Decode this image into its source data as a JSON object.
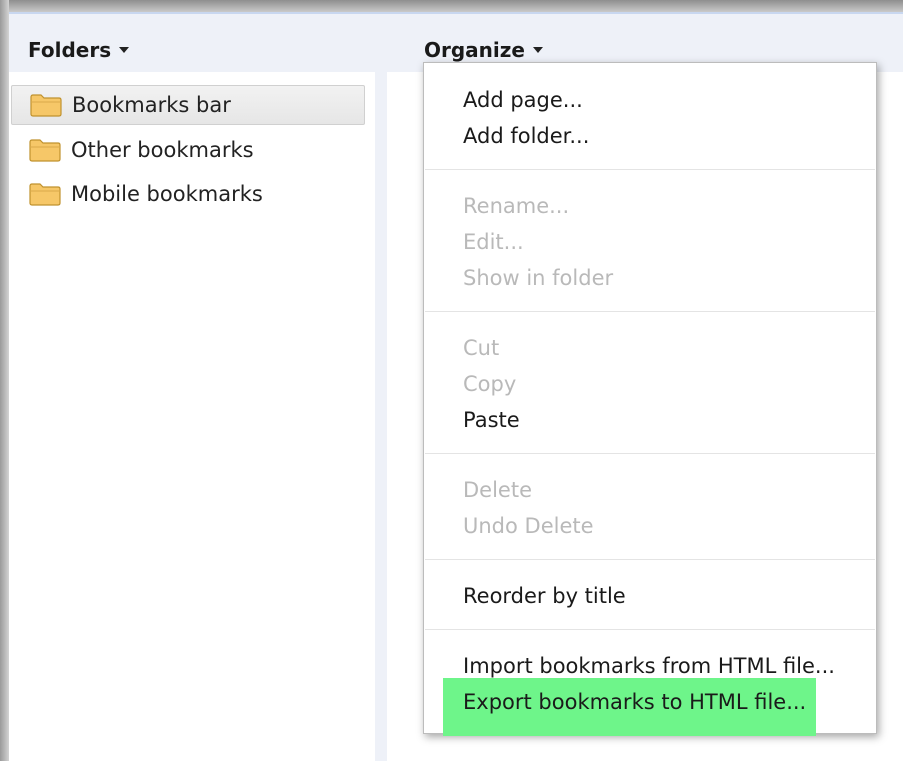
{
  "header": {
    "folders_label": "Folders",
    "organize_label": "Organize"
  },
  "sidebar": {
    "items": [
      {
        "label": "Bookmarks bar",
        "selected": true
      },
      {
        "label": "Other bookmarks",
        "selected": false
      },
      {
        "label": "Mobile bookmarks",
        "selected": false
      }
    ]
  },
  "organize_menu": {
    "items": [
      {
        "label": "Add page...",
        "enabled": true
      },
      {
        "label": "Add folder...",
        "enabled": true
      },
      {
        "label": "Rename...",
        "enabled": false
      },
      {
        "label": "Edit...",
        "enabled": false
      },
      {
        "label": "Show in folder",
        "enabled": false
      },
      {
        "label": "Cut",
        "enabled": false
      },
      {
        "label": "Copy",
        "enabled": false
      },
      {
        "label": "Paste",
        "enabled": true
      },
      {
        "label": "Delete",
        "enabled": false
      },
      {
        "label": "Undo Delete",
        "enabled": false
      },
      {
        "label": "Reorder by title",
        "enabled": true
      },
      {
        "label": "Import bookmarks from HTML file...",
        "enabled": true
      },
      {
        "label": "Export bookmarks to HTML file...",
        "enabled": true,
        "highlighted": true
      }
    ],
    "highlight_color": "#6ef58a"
  },
  "icons": {
    "folder": "folder-icon",
    "dropdown": "caret-down-icon"
  }
}
